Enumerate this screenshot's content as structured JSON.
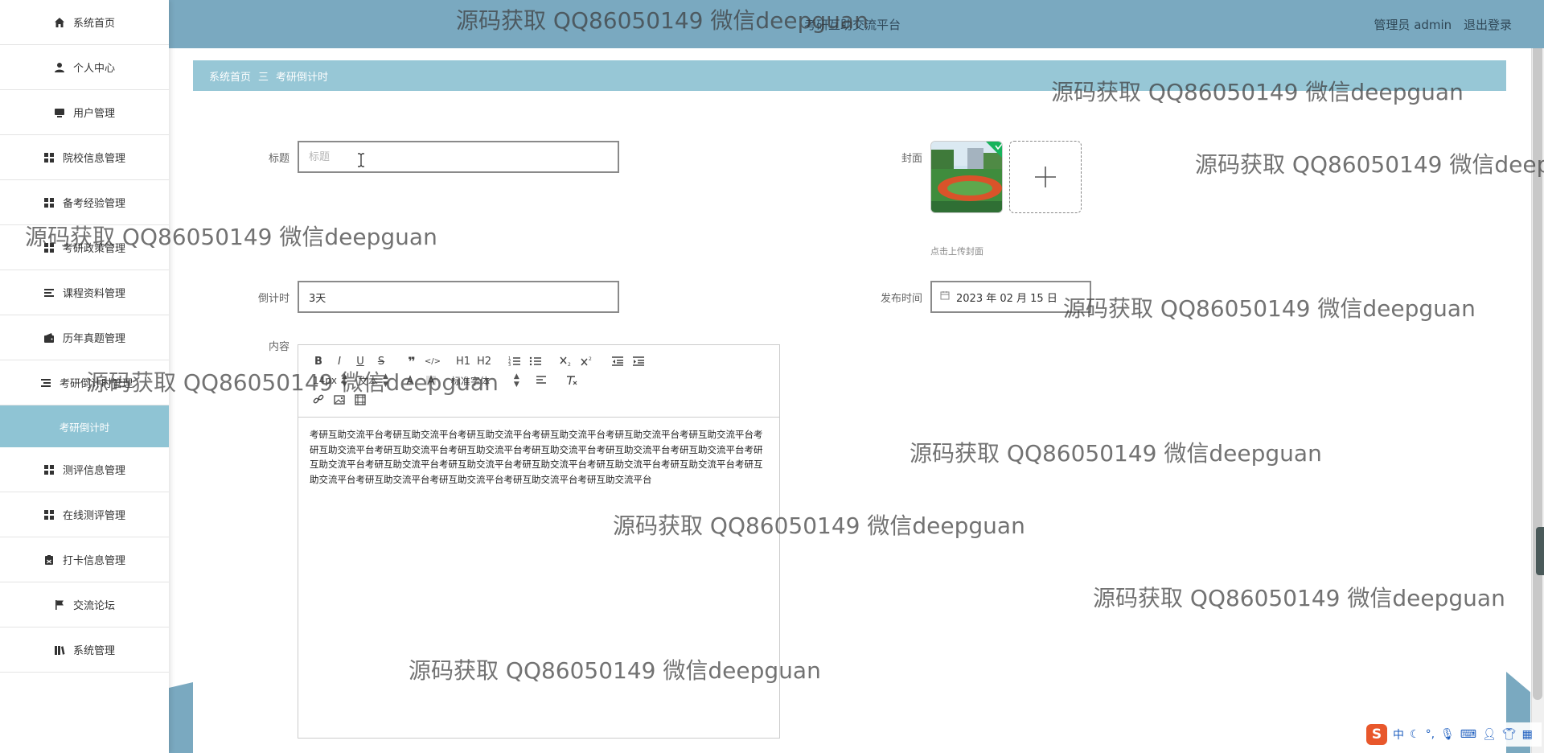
{
  "sidebar": {
    "items": [
      {
        "label": "系统首页",
        "icon": "home-icon"
      },
      {
        "label": "个人中心",
        "icon": "user-icon"
      },
      {
        "label": "用户管理",
        "icon": "monitor-icon"
      },
      {
        "label": "院校信息管理",
        "icon": "grid-icon"
      },
      {
        "label": "备考经验管理",
        "icon": "grid-icon"
      },
      {
        "label": "考研政策管理",
        "icon": "grid-icon"
      },
      {
        "label": "课程资料管理",
        "icon": "list-icon"
      },
      {
        "label": "历年真题管理",
        "icon": "wallet-icon"
      },
      {
        "label": "考研倒计时管理",
        "icon": "list-icon"
      },
      {
        "label": "考研倒计时",
        "icon": ""
      },
      {
        "label": "测评信息管理",
        "icon": "grid-icon"
      },
      {
        "label": "在线测评管理",
        "icon": "grid-icon"
      },
      {
        "label": "打卡信息管理",
        "icon": "clipboard-icon"
      },
      {
        "label": "交流论坛",
        "icon": "flag-icon"
      },
      {
        "label": "系统管理",
        "icon": "book-icon"
      }
    ]
  },
  "header": {
    "title": "考研互助交流平台",
    "user_label": "管理员 admin",
    "logout_label": "退出登录"
  },
  "breadcrumb": {
    "home": "系统首页",
    "separator": "三",
    "current": "考研倒计时"
  },
  "form": {
    "title_label": "标题",
    "title_placeholder": "标题",
    "title_value": "",
    "cover_label": "封面",
    "cover_hint": "点击上传封面",
    "countdown_label": "倒计时",
    "countdown_value": "3天",
    "publish_label": "发布时间",
    "publish_value": "2023 年 02 月 15 日",
    "content_label": "内容"
  },
  "editor": {
    "toolbar_row1": [
      "B",
      "I",
      "U",
      "S",
      "❞",
      "</>",
      "H1",
      "H2"
    ],
    "font_size": "14px",
    "paragraph": "文本",
    "font_family": "标准字体",
    "content": "考研互助交流平台考研互助交流平台考研互助交流平台考研互助交流平台考研互助交流平台考研互助交流平台考研互助交流平台考研互助交流平台考研互助交流平台考研互助交流平台考研互助交流平台考研互助交流平台考研互助交流平台考研互助交流平台考研互助交流平台考研互助交流平台考研互助交流平台考研互助交流平台考研互助交流平台考研互助交流平台考研互助交流平台考研互助交流平台考研互助交流平台"
  },
  "watermark": {
    "text": "源码获取 QQ86050149 微信deepguan"
  },
  "ime": {
    "logo": "S",
    "mode": "中"
  },
  "colors": {
    "header": "#7aa9c0",
    "breadcrumb": "#97c7d6",
    "active_menu": "#8fc4d4"
  }
}
